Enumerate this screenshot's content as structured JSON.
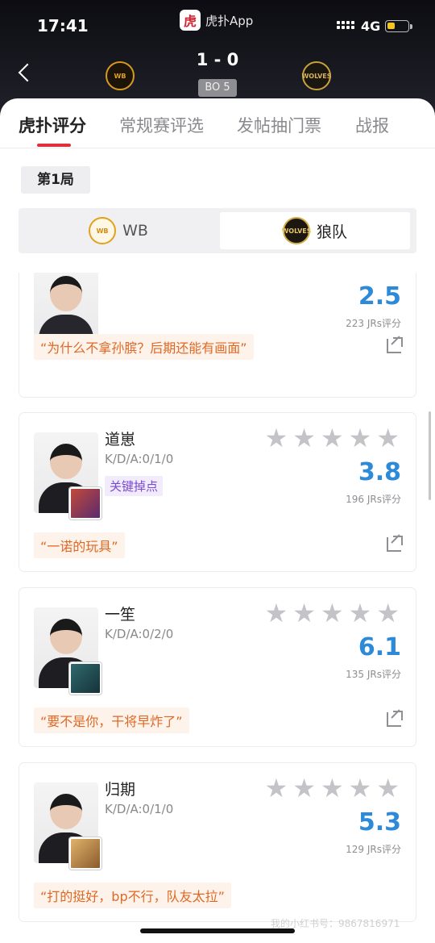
{
  "status_bar": {
    "time": "17:41",
    "network": "4G",
    "battery_level": 0.4
  },
  "app_badge": {
    "logo_char": "虎",
    "name": "虎扑App"
  },
  "match": {
    "score": "1 - 0",
    "format": "BO 5",
    "home_logo_text": "WB",
    "away_logo_text": "WOLVES"
  },
  "tabs": [
    {
      "label": "虎扑评分",
      "active": true
    },
    {
      "label": "常规赛评选",
      "active": false
    },
    {
      "label": "发帖抽门票",
      "active": false
    },
    {
      "label": "战报",
      "active": false
    }
  ],
  "round": "第1局",
  "team_switch": {
    "left": {
      "label": "WB",
      "logo_text": "WB"
    },
    "right": {
      "label": "狼队",
      "logo_text": "WOLVES",
      "selected": true
    }
  },
  "cards": [
    {
      "name": "",
      "kda": "",
      "tag": "",
      "score": "2.5",
      "ratings": "223 JRs评分",
      "comment": "“为什么不拿孙膑？后期还能有画面”",
      "is_coach": true
    },
    {
      "name": "道崽",
      "kda": "K/D/A:0/1/0",
      "tag": "关键掉点",
      "score": "3.8",
      "ratings": "196 JRs评分",
      "comment": "“一诺的玩具”"
    },
    {
      "name": "一笙",
      "kda": "K/D/A:0/2/0",
      "tag": "",
      "score": "6.1",
      "ratings": "135 JRs评分",
      "comment": "“要不是你，干将早炸了”"
    },
    {
      "name": "归期",
      "kda": "K/D/A:0/1/0",
      "tag": "",
      "score": "5.3",
      "ratings": "129 JRs评分",
      "comment": "“打的挺好，bp不行，队友太拉”"
    }
  ],
  "watermark": "我的小红书号：9867816971",
  "colors": {
    "accent": "#e0313a",
    "score_blue": "#2d8ad8",
    "comment_orange": "#e06825",
    "tag_purple": "#7a4bd0"
  }
}
